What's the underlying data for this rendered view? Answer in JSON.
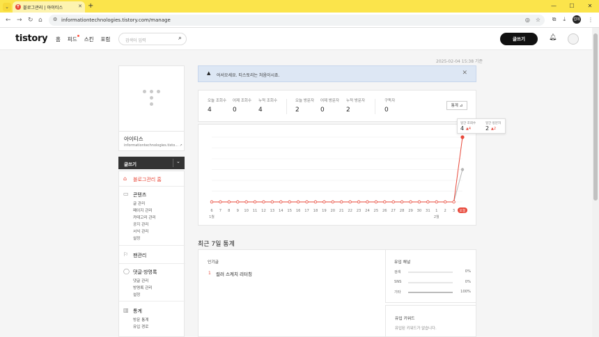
{
  "browser": {
    "tab_title": "블로그관리 | 아이티스",
    "tab_favicon": "T",
    "url": "informationtechnologies.tistory.com/manage",
    "profile_label": "업데"
  },
  "header": {
    "logo": "tistory",
    "nav": [
      "홈",
      "피드",
      "스킨",
      "포럼"
    ],
    "search_placeholder": "검색어 입력",
    "write_label": "글쓰기"
  },
  "timestamp": "2025-02-04 15:38 기준",
  "sidebar": {
    "blog_name": "아이티스",
    "blog_url": "informationtechnologies.tisto...",
    "write_label": "글쓰기",
    "home_label": "블로그관리 홈",
    "sections": [
      {
        "title": "콘텐츠",
        "items": [
          "글 관리",
          "페이지 관리",
          "카테고리 관리",
          "공지 관리",
          "서식 관리",
          "설정"
        ]
      },
      {
        "title": "팬관리",
        "items": []
      },
      {
        "title": "댓글·방명록",
        "items": [
          "댓글 관리",
          "방명록 관리",
          "설정"
        ]
      },
      {
        "title": "통계",
        "items": [
          "방문 통계",
          "유입 경로"
        ]
      }
    ]
  },
  "notice": {
    "text": "어서오세요. 티스토리는 처음이시죠."
  },
  "stats": {
    "items": [
      {
        "label": "오늘 조회수",
        "value": "4"
      },
      {
        "label": "어제 조회수",
        "value": "0"
      },
      {
        "label": "누적 조회수",
        "value": "4"
      },
      {
        "label": "오늘 방문자",
        "value": "2"
      },
      {
        "label": "어제 방문자",
        "value": "0"
      },
      {
        "label": "누적 방문자",
        "value": "2"
      },
      {
        "label": "구독자",
        "value": "0"
      }
    ],
    "button_label": "통계"
  },
  "tooltip": {
    "views_label": "일간 조회수",
    "views_value": "4",
    "views_delta": "▲4",
    "visitors_label": "일간 방문자",
    "visitors_value": "2",
    "visitors_delta": "▲2"
  },
  "chart_data": {
    "type": "line",
    "categories": [
      "6",
      "7",
      "8",
      "9",
      "10",
      "11",
      "12",
      "13",
      "14",
      "15",
      "16",
      "17",
      "18",
      "19",
      "20",
      "21",
      "22",
      "23",
      "24",
      "25",
      "26",
      "27",
      "28",
      "29",
      "30",
      "31",
      "1",
      "2",
      "3",
      "오늘"
    ],
    "month_labels": [
      {
        "index": 0,
        "label": "1월"
      },
      {
        "index": 26,
        "label": "2월"
      }
    ],
    "series": [
      {
        "name": "일간 조회수",
        "color": "#e8483a",
        "values": [
          0,
          0,
          0,
          0,
          0,
          0,
          0,
          0,
          0,
          0,
          0,
          0,
          0,
          0,
          0,
          0,
          0,
          0,
          0,
          0,
          0,
          0,
          0,
          0,
          0,
          0,
          0,
          0,
          0,
          4
        ]
      },
      {
        "name": "일간 방문자",
        "color": "#b5b5b5",
        "values": [
          0,
          0,
          0,
          0,
          0,
          0,
          0,
          0,
          0,
          0,
          0,
          0,
          0,
          0,
          0,
          0,
          0,
          0,
          0,
          0,
          0,
          0,
          0,
          0,
          0,
          0,
          0,
          0,
          0,
          2
        ]
      }
    ],
    "ylim": [
      0,
      4
    ],
    "grid": true
  },
  "recent": {
    "title": "최근 7일 통계",
    "popular_title": "인기글",
    "popular": [
      {
        "rank": "1",
        "title": "컬러 스케치 리터칭"
      }
    ],
    "inflow_title": "유입 채널",
    "inflow": [
      {
        "label": "검색",
        "pct": "0%",
        "value": 0
      },
      {
        "label": "SNS",
        "pct": "0%",
        "value": 0
      },
      {
        "label": "기타",
        "pct": "100%",
        "value": 100
      }
    ],
    "keyword_title": "유입 키워드",
    "keyword_empty": "유입된 키워드가 없습니다."
  }
}
